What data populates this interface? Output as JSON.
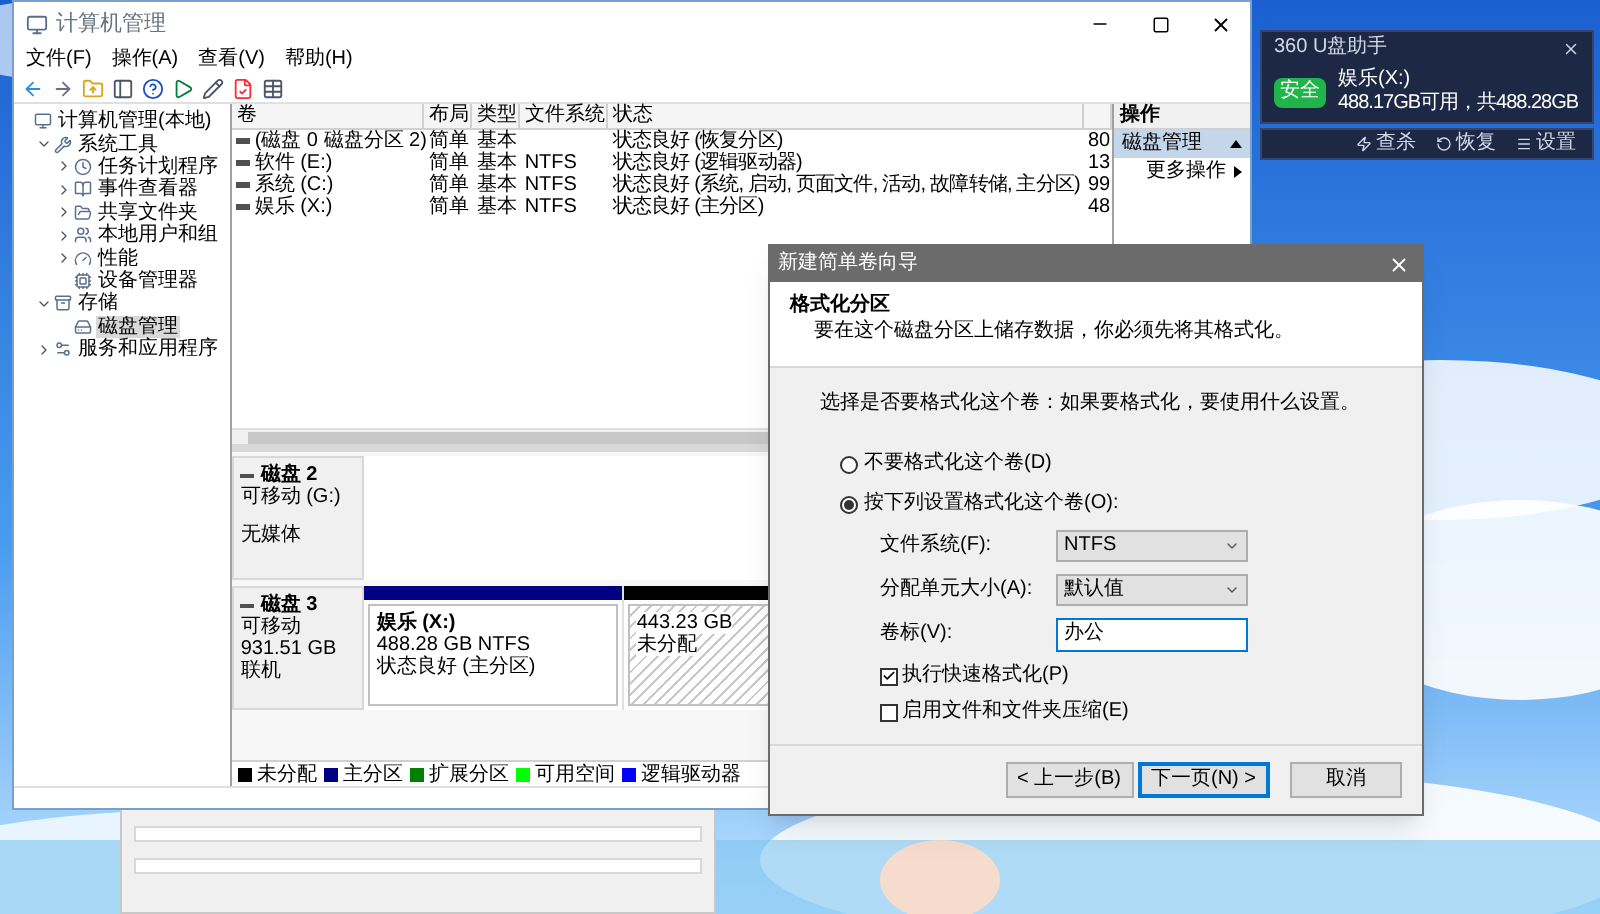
{
  "main_window": {
    "title": "计算机管理",
    "menu": [
      "文件(F)",
      "操作(A)",
      "查看(V)",
      "帮助(H)"
    ],
    "tree": [
      {
        "label": "计算机管理(本地)",
        "selected": false,
        "children": [
          {
            "label": "系统工具",
            "expanded": true,
            "selected": false,
            "children": [
              {
                "label": "任务计划程序",
                "expanded": false,
                "selected": false
              },
              {
                "label": "事件查看器",
                "expanded": false,
                "selected": false
              },
              {
                "label": "共享文件夹",
                "expanded": false,
                "selected": false
              },
              {
                "label": "本地用户和组",
                "expanded": false,
                "selected": false
              },
              {
                "label": "性能",
                "expanded": false,
                "selected": false
              },
              {
                "label": "设备管理器",
                "selected": false
              }
            ]
          },
          {
            "label": "存储",
            "expanded": true,
            "selected": false,
            "children": [
              {
                "label": "磁盘管理",
                "selected": true
              }
            ]
          },
          {
            "label": "服务和应用程序",
            "expanded": false,
            "selected": false
          }
        ]
      }
    ],
    "volumes": {
      "columns": [
        "卷",
        "布局",
        "类型",
        "文件系统",
        "状态"
      ],
      "rows": [
        {
          "volume": "(磁盘 0 磁盘分区 2)",
          "layout": "简单",
          "type": "基本",
          "status": "状态良好 (恢复分区)",
          "column_6": "80"
        },
        {
          "volume": "软件 (E:)",
          "layout": "简单",
          "type": "基本",
          "file_system": "NTFS",
          "status": "状态良好 (逻辑驱动器)",
          "column_6": "13"
        },
        {
          "volume": "系统 (C:)",
          "layout": "简单",
          "type": "基本",
          "file_system": "NTFS",
          "status": "状态良好 (系统, 启动, 页面文件, 活动, 故障转储, 主分区)",
          "column_6": "99"
        },
        {
          "volume": "娱乐 (X:)",
          "layout": "简单",
          "type": "基本",
          "file_system": "NTFS",
          "status": "状态良好 (主分区)",
          "column_6": "48"
        }
      ]
    },
    "disks": [
      {
        "name": "磁盘 2",
        "type": "可移动 (G:)",
        "status": "无媒体"
      },
      {
        "name": "磁盘 3",
        "type": "可移动",
        "size": "931.51 GB",
        "status": "联机",
        "partitions": [
          {
            "kind": "primary",
            "name": "娱乐 (X:)",
            "size": "488.28 GB NTFS",
            "status": "状态良好 (主分区)"
          },
          {
            "kind": "unallocated",
            "size": "443.23 GB",
            "status": "未分配"
          }
        ]
      }
    ],
    "legend": [
      {
        "label": "未分配",
        "color": "#000000"
      },
      {
        "label": "主分区",
        "color": "#000080"
      },
      {
        "label": "扩展分区",
        "color": "#008000"
      },
      {
        "label": "可用空间",
        "color": "#00ff00"
      },
      {
        "label": "逻辑驱动器",
        "color": "#0000ff"
      }
    ],
    "actions": {
      "title": "操作",
      "section": {
        "label": "磁盘管理",
        "expanded": true
      },
      "items": [
        "更多操作"
      ]
    }
  },
  "dialog": {
    "title": "新建简单卷向导",
    "heading": "格式化分区",
    "subheading": "要在这个磁盘分区上储存数据，你必须先将其格式化。",
    "prompt": "选择是否要格式化这个卷：如果要格式化，要使用什么设置。",
    "options": [
      {
        "label": "不要格式化这个卷(D)",
        "selected": false
      },
      {
        "label": "按下列设置格式化这个卷(O):",
        "selected": true
      }
    ],
    "fields": [
      {
        "kind": "dropdown",
        "label": "文件系统(F):",
        "value": "NTFS",
        "focused": false
      },
      {
        "kind": "dropdown",
        "label": "分配单元大小(A):",
        "value": "默认值",
        "focused": false
      },
      {
        "kind": "text",
        "label": "卷标(V):",
        "value": "办公",
        "focused": true
      }
    ],
    "checkboxes": [
      {
        "label": "执行快速格式化(P)",
        "checked": true
      },
      {
        "label": "启用文件和文件夹压缩(E)",
        "checked": false
      }
    ],
    "buttons": [
      {
        "label": "< 上一步(B)",
        "default": false
      },
      {
        "label": "下一页(N) >",
        "default": true
      },
      {
        "label": "取消",
        "default": false
      }
    ]
  },
  "widget": {
    "title": "360 U盘助手",
    "badge": "安全",
    "drive": "娱乐(X:)",
    "info": "488.17GB可用，共488.28GB",
    "actions": [
      "查杀",
      "恢复",
      "设置"
    ]
  }
}
